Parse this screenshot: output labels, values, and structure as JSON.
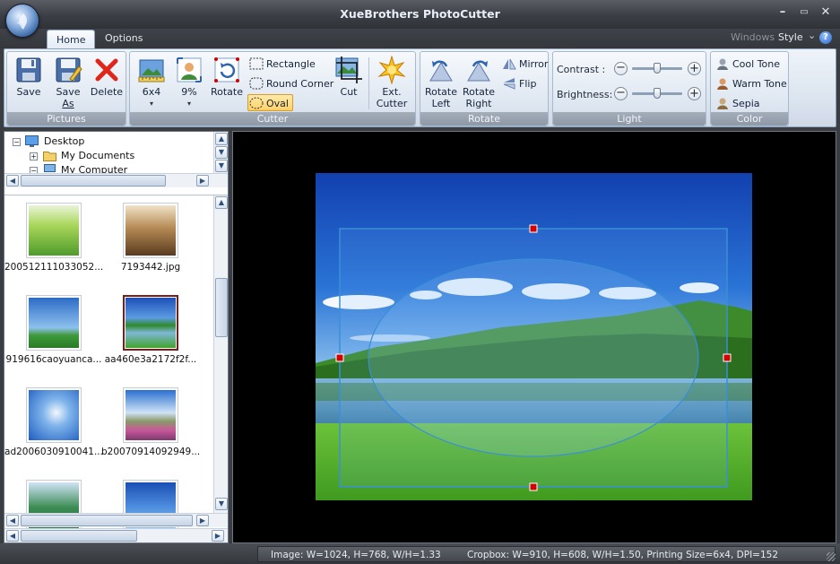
{
  "app": {
    "title": "XueBrothers PhotoCutter"
  },
  "tabs": [
    {
      "label": "Home",
      "active": true
    },
    {
      "label": "Options",
      "active": false
    }
  ],
  "topright": {
    "windows": "Windows",
    "style": "Style",
    "chevron": "⌄"
  },
  "ribbon": {
    "pictures": {
      "label": "Pictures",
      "save": "Save",
      "save_as_1": "Save",
      "save_as_2": "As",
      "delete": "Delete"
    },
    "cutter": {
      "label": "Cutter",
      "size": "6x4",
      "percent": "9%",
      "rotate": "Rotate",
      "rectangle": "Rectangle",
      "round_corner": "Round Corner",
      "oval": "Oval",
      "cut": "Cut",
      "ext_1": "Ext.",
      "ext_2": "Cutter"
    },
    "rotate": {
      "label": "Rotate",
      "left_1": "Rotate",
      "left_2": "Left",
      "right_1": "Rotate",
      "right_2": "Right",
      "mirror": "Mirror",
      "flip": "Flip"
    },
    "light": {
      "label": "Light",
      "contrast": "Contrast",
      "contrast_colon": ":",
      "brightness": "Brightness:",
      "contrast_level": 0.5,
      "brightness_level": 0.5
    },
    "color": {
      "label": "Color",
      "cool": "Cool Tone",
      "warm": "Warm Tone",
      "sepia": "Sepia"
    }
  },
  "tree": [
    {
      "label": "Desktop",
      "expander": "−"
    },
    {
      "label": "My Documents",
      "expander": "+"
    },
    {
      "label": "My Computer",
      "expander": "−"
    }
  ],
  "thumbnails": [
    {
      "name": "200512111033052...",
      "selected": false
    },
    {
      "name": "7193442.jpg",
      "selected": false
    },
    {
      "name": "919616caoyuanca...",
      "selected": false
    },
    {
      "name": "aa460e3a2172f2f...",
      "selected": true
    },
    {
      "name": "ad2006030910041...",
      "selected": false
    },
    {
      "name": "b20070914092949...",
      "selected": false
    },
    {
      "name": "",
      "selected": false
    },
    {
      "name": "",
      "selected": false
    }
  ],
  "status": {
    "image": "Image: W=1024, H=768, W/H=1.33",
    "cropbox": "Cropbox: W=910, H=608, W/H=1.50, Printing Size=6x4, DPI=152"
  },
  "colors": {
    "accent": "#3a78c4",
    "selection": "#7a1c1c",
    "handle": "#d40000"
  }
}
